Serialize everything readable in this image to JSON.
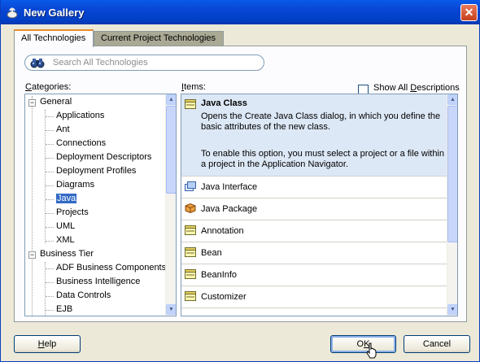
{
  "window": {
    "title": "New Gallery",
    "close_icon": "close-icon"
  },
  "tabs": [
    {
      "label": "All Technologies",
      "active": true
    },
    {
      "label": "Current Project Technologies",
      "active": false
    }
  ],
  "search": {
    "placeholder": "Search All Technologies",
    "icon": "binoculars-icon"
  },
  "categories": {
    "label_pre": "",
    "label_u": "C",
    "label_post": "ategories:",
    "tree": [
      {
        "label": "General",
        "level": 0,
        "expanded": true
      },
      {
        "label": "Applications",
        "level": 1
      },
      {
        "label": "Ant",
        "level": 1
      },
      {
        "label": "Connections",
        "level": 1
      },
      {
        "label": "Deployment Descriptors",
        "level": 1
      },
      {
        "label": "Deployment Profiles",
        "level": 1
      },
      {
        "label": "Diagrams",
        "level": 1
      },
      {
        "label": "Java",
        "level": 1,
        "selected": true
      },
      {
        "label": "Projects",
        "level": 1
      },
      {
        "label": "UML",
        "level": 1
      },
      {
        "label": "XML",
        "level": 1
      },
      {
        "label": "Business Tier",
        "level": 0,
        "expanded": true
      },
      {
        "label": "ADF Business Components",
        "level": 1
      },
      {
        "label": "Business Intelligence",
        "level": 1
      },
      {
        "label": "Data Controls",
        "level": 1
      },
      {
        "label": "EJB",
        "level": 1
      }
    ]
  },
  "items": {
    "label_u": "I",
    "label_post": "tems:",
    "show_all_label_pre": "Show All ",
    "show_all_label_u": "D",
    "show_all_label_post": "escriptions",
    "show_all_checked": false,
    "list": [
      {
        "name": "Java Class",
        "selected": true,
        "icon": "java-class-icon",
        "description": "Opens the Create Java Class dialog, in which you define the basic attributes of the new class.",
        "note": "To enable this option, you must select a project or a file within a project in the Application Navigator."
      },
      {
        "name": "Java Interface",
        "icon": "java-interface-icon"
      },
      {
        "name": "Java Package",
        "icon": "java-package-icon"
      },
      {
        "name": "Annotation",
        "icon": "annotation-icon"
      },
      {
        "name": "Bean",
        "icon": "bean-icon"
      },
      {
        "name": "BeanInfo",
        "icon": "beaninfo-icon"
      },
      {
        "name": "Customizer",
        "icon": "customizer-icon"
      }
    ]
  },
  "buttons": {
    "help_u": "H",
    "help_post": "elp",
    "ok_pre": "O",
    "ok_u": "K",
    "cancel": "Cancel"
  }
}
